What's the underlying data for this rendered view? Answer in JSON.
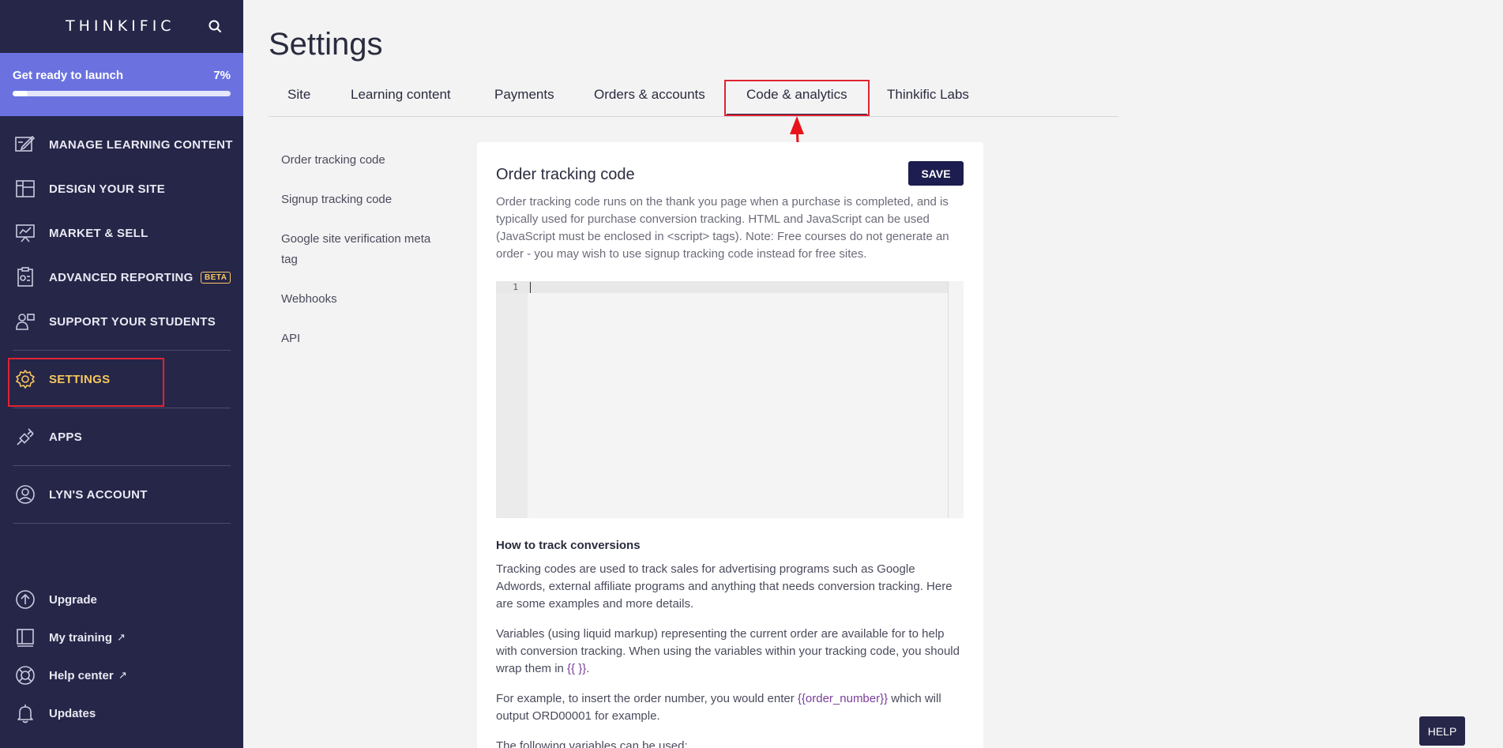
{
  "sidebar": {
    "logo": "THINKIFIC",
    "search_icon": "search-icon",
    "launch": {
      "label": "Get ready to launch",
      "percent_text": "7%",
      "progress": 0.07
    },
    "nav": [
      {
        "label": "MANAGE LEARNING CONTENT",
        "icon": "edit-content-icon"
      },
      {
        "label": "DESIGN YOUR SITE",
        "icon": "layout-icon"
      },
      {
        "label": "MARKET & SELL",
        "icon": "presentation-chart-icon"
      },
      {
        "label": "ADVANCED REPORTING",
        "icon": "report-icon",
        "badge": "BETA"
      },
      {
        "label": "SUPPORT YOUR STUDENTS",
        "icon": "students-icon"
      },
      {
        "label": "SETTINGS",
        "icon": "gear-icon",
        "active": true
      },
      {
        "label": "APPS",
        "icon": "plug-icon"
      },
      {
        "label": "LYN'S ACCOUNT",
        "icon": "user-circle-icon"
      }
    ],
    "bottom": [
      {
        "label": "Upgrade",
        "icon": "arrow-up-circle-icon"
      },
      {
        "label": "My training",
        "icon": "book-icon",
        "external": "↗"
      },
      {
        "label": "Help center",
        "icon": "lifebuoy-icon",
        "external": "↗"
      },
      {
        "label": "Updates",
        "icon": "bell-icon"
      }
    ]
  },
  "main": {
    "title": "Settings",
    "tabs": [
      {
        "label": "Site"
      },
      {
        "label": "Learning content"
      },
      {
        "label": "Payments"
      },
      {
        "label": "Orders & accounts"
      },
      {
        "label": "Code & analytics",
        "active": true
      },
      {
        "label": "Thinkific Labs"
      }
    ],
    "subnav": [
      {
        "label": "Order tracking code"
      },
      {
        "label": "Signup tracking code"
      },
      {
        "label": "Google site verification meta tag"
      },
      {
        "label": "Webhooks"
      },
      {
        "label": "API"
      }
    ],
    "card": {
      "title": "Order tracking code",
      "save_label": "SAVE",
      "description": "Order tracking code runs on the thank you page when a purchase is completed, and is typically used for purchase conversion tracking. HTML and JavaScript can be used (JavaScript must be enclosed in <script> tags). Note: Free courses do not generate an order - you may wish to use signup tracking code instead for free sites.",
      "editor_line_number": "1",
      "section_title": "How to track conversions",
      "para1": "Tracking codes are used to track sales for advertising programs such as Google Adwords, external affiliate programs and anything that needs conversion tracking. Here are some examples and more details.",
      "para2_pre": "Variables (using liquid markup) representing the current order are available for to help with conversion tracking. When using the variables within your tracking code, you should wrap them in ",
      "para2_code": "{{ }}",
      "para2_post": ".",
      "para3_pre": "For example, to insert the order number, you would enter ",
      "para3_code": "{{order_number}}",
      "para3_post": " which will output ORD00001 for example.",
      "para4": "The following variables can be used:"
    }
  },
  "help_label": "HELP",
  "colors": {
    "sidebar_bg": "#262649",
    "accent_yellow": "#f7c75e",
    "launch_bg": "#6b72e0",
    "highlight_red": "#e0232f"
  }
}
